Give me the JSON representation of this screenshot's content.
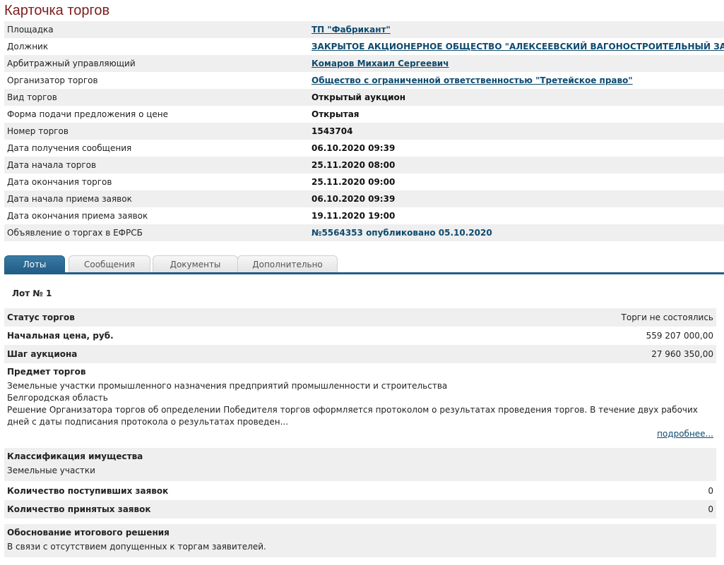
{
  "page_title": "Карточка торгов",
  "info_rows": [
    {
      "key": "Площадка",
      "value": "ТП \"Фабрикант\"",
      "link": true
    },
    {
      "key": "Должник",
      "value": "ЗАКРЫТОЕ АКЦИОНЕРНОЕ ОБЩЕСТВО \"АЛЕКСЕЕВСКИЙ ВАГОНОСТРОИТЕЛЬНЫЙ ЗАВОД\"",
      "link": true
    },
    {
      "key": "Арбитражный управляющий",
      "value": "Комаров Михаил Сергеевич",
      "link": true
    },
    {
      "key": "Организатор торгов",
      "value": "Общество с ограниченной ответственностью \"Третейское право\"",
      "link": true
    },
    {
      "key": "Вид торгов",
      "value": "Открытый аукцион",
      "link": false
    },
    {
      "key": "Форма подачи предложения о цене",
      "value": "Открытая",
      "link": false
    },
    {
      "key": "Номер торгов",
      "value": "1543704",
      "link": false
    },
    {
      "key": "Дата получения сообщения",
      "value": "06.10.2020 09:39",
      "link": false
    },
    {
      "key": "Дата начала торгов",
      "value": "25.11.2020 08:00",
      "link": false
    },
    {
      "key": "Дата окончания торгов",
      "value": "25.11.2020 09:00",
      "link": false
    },
    {
      "key": "Дата начала приема заявок",
      "value": "06.10.2020 09:39",
      "link": false
    },
    {
      "key": "Дата окончания приема заявок",
      "value": "19.11.2020 19:00",
      "link": false
    },
    {
      "key": "Объявление о торгах в ЕФРСБ",
      "value": "№5564353 опубликовано 05.10.2020",
      "link": "plain"
    }
  ],
  "tabs": [
    {
      "label": "Лоты",
      "active": true
    },
    {
      "label": "Сообщения",
      "active": false
    },
    {
      "label": "Документы",
      "active": false
    },
    {
      "label": "Дополнительно",
      "active": false
    }
  ],
  "lot": {
    "title": "Лот № 1",
    "status_label": "Статус торгов",
    "status_value": "Торги не состоялись",
    "start_price_label": "Начальная цена, руб.",
    "start_price_value": "559 207 000,00",
    "step_label": "Шаг аукциона",
    "step_value": "27 960 350,00",
    "subject_label": "Предмет торгов",
    "subject_lines": [
      "Земельные участки промышленного назначения предприятий промышленности и строительства",
      "Белгородская область",
      "Решение Организатора торгов об определении Победителя торгов оформляется протоколом о результатах проведения торгов. В течение двух рабочих дней с даты подписания протокола о результатах проведен..."
    ],
    "more_link": "подробнее...",
    "classification_label": "Классификация имущества",
    "classification_value": "Земельные участки",
    "received_label": "Количество поступивших заявок",
    "received_value": "0",
    "accepted_label": "Количество принятых заявок",
    "accepted_value": "0",
    "reason_label": "Обоснование итогового решения",
    "reason_value": "В связи с отсутствием допущенных к торгам заявителей."
  }
}
